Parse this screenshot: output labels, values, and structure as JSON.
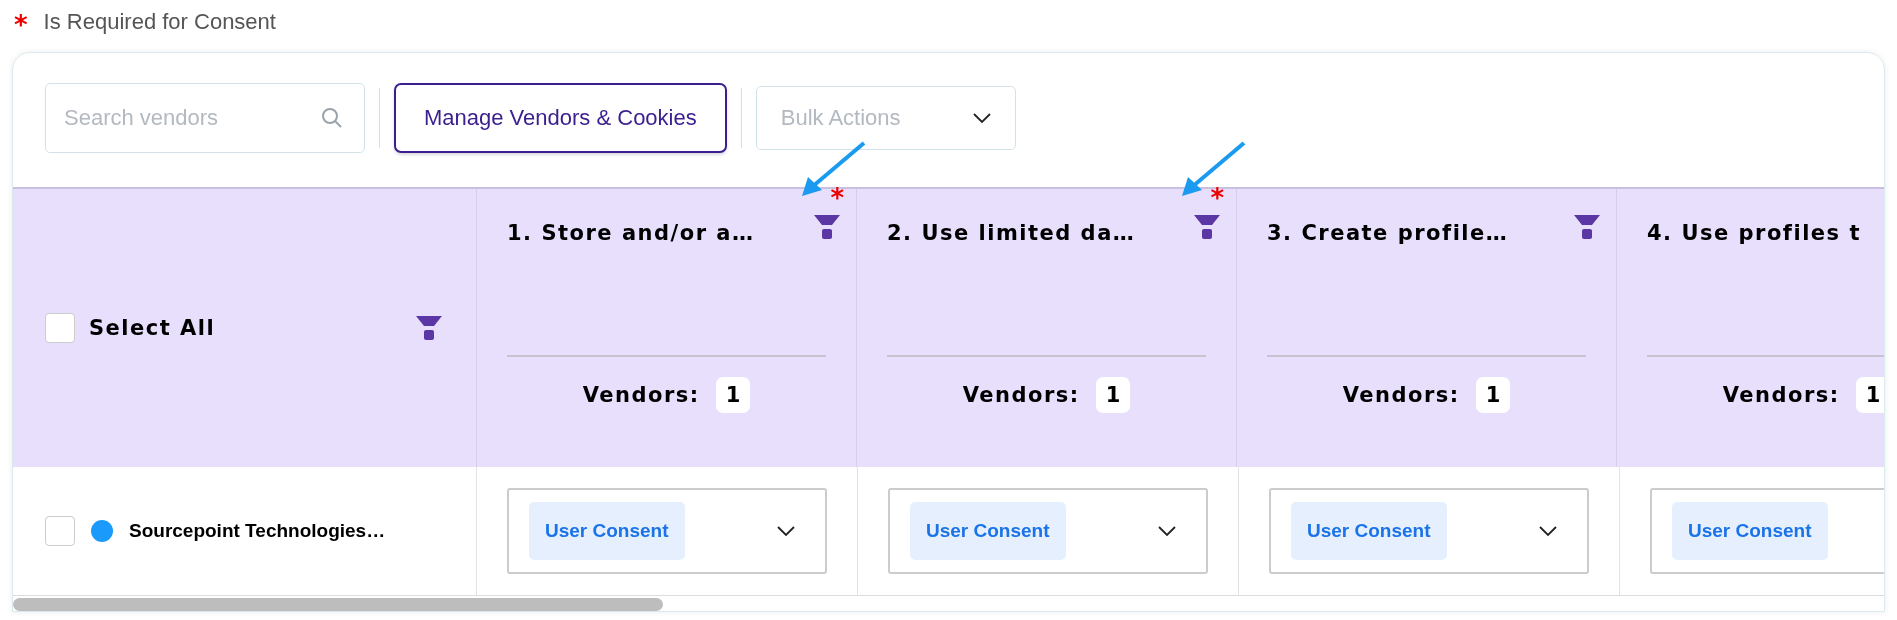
{
  "legend": {
    "mark": "*",
    "label": "Is Required for Consent"
  },
  "toolbar": {
    "search": {
      "placeholder": "Search vendors"
    },
    "manage_button": "Manage Vendors & Cookies",
    "bulk_actions": {
      "placeholder": "Bulk Actions"
    }
  },
  "table": {
    "select_all": {
      "label": "Select All",
      "checked": false
    },
    "columns": [
      {
        "title": "1. Store and/or a…",
        "required": true,
        "annotation_arrow": true,
        "filter": true,
        "vendors_label": "Vendors:",
        "vendors_count": "1"
      },
      {
        "title": "2. Use limited da…",
        "required": true,
        "annotation_arrow": true,
        "filter": true,
        "vendors_label": "Vendors:",
        "vendors_count": "1"
      },
      {
        "title": "3. Create profile…",
        "required": false,
        "annotation_arrow": false,
        "filter": true,
        "vendors_label": "Vendors:",
        "vendors_count": "1"
      },
      {
        "title": "4. Use profiles t",
        "vendors_label": "Vendors:",
        "vendors_count": "1"
      }
    ],
    "rows": [
      {
        "name": "Sourcepoint Technologies…",
        "checked": false,
        "color": "#1a9bfc",
        "cells": [
          {
            "value": "User Consent",
            "chevron": true
          },
          {
            "value": "User Consent",
            "chevron": true
          },
          {
            "value": "User Consent",
            "chevron": true
          },
          {
            "value": "User Consent"
          }
        ]
      }
    ]
  }
}
